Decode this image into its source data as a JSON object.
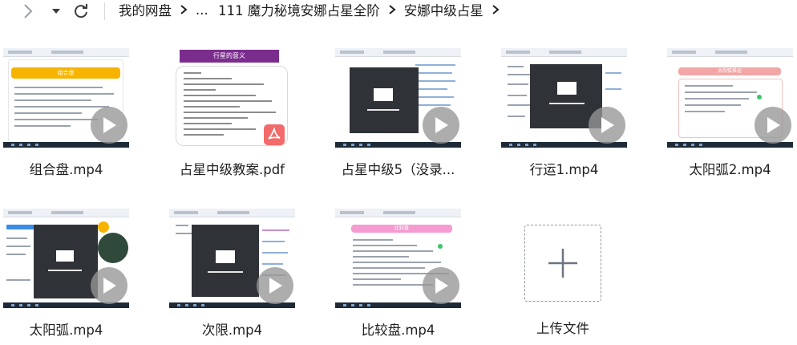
{
  "toolbar": {
    "forward_icon": "chevron-right-icon",
    "dropdown_icon": "caret-down-icon",
    "refresh_icon": "refresh-icon"
  },
  "breadcrumb": {
    "root": "我的网盘",
    "ellipsis": "...",
    "folder1": "111 魔力秘境安娜占星全阶",
    "folder2": "安娜中级占星"
  },
  "files": [
    {
      "name": "组合盘.mp4",
      "type": "video",
      "accent": "#f6b400",
      "banner_text": "组合盘"
    },
    {
      "name": "占星中级教案.pdf",
      "type": "pdf",
      "banner_text": "行星的意义"
    },
    {
      "name": "占星中级5（没录...",
      "type": "video"
    },
    {
      "name": "行运1.mp4",
      "type": "video"
    },
    {
      "name": "太阳弧2.mp4",
      "type": "video",
      "accent": "#f2a6a6",
      "banner_text": "太阳弧推运"
    },
    {
      "name": "太阳弧.mp4",
      "type": "video",
      "accent": "#f6b400"
    },
    {
      "name": "次限.mp4",
      "type": "video"
    },
    {
      "name": "比较盘.mp4",
      "type": "video",
      "accent": "#f59bd2",
      "banner_text": "比较盘"
    }
  ],
  "upload": {
    "label": "上传文件",
    "icon": "plus-icon"
  },
  "colors": {
    "icon_gray": "#5f6368",
    "text": "#1f1f1f",
    "play_overlay": "#969696"
  }
}
